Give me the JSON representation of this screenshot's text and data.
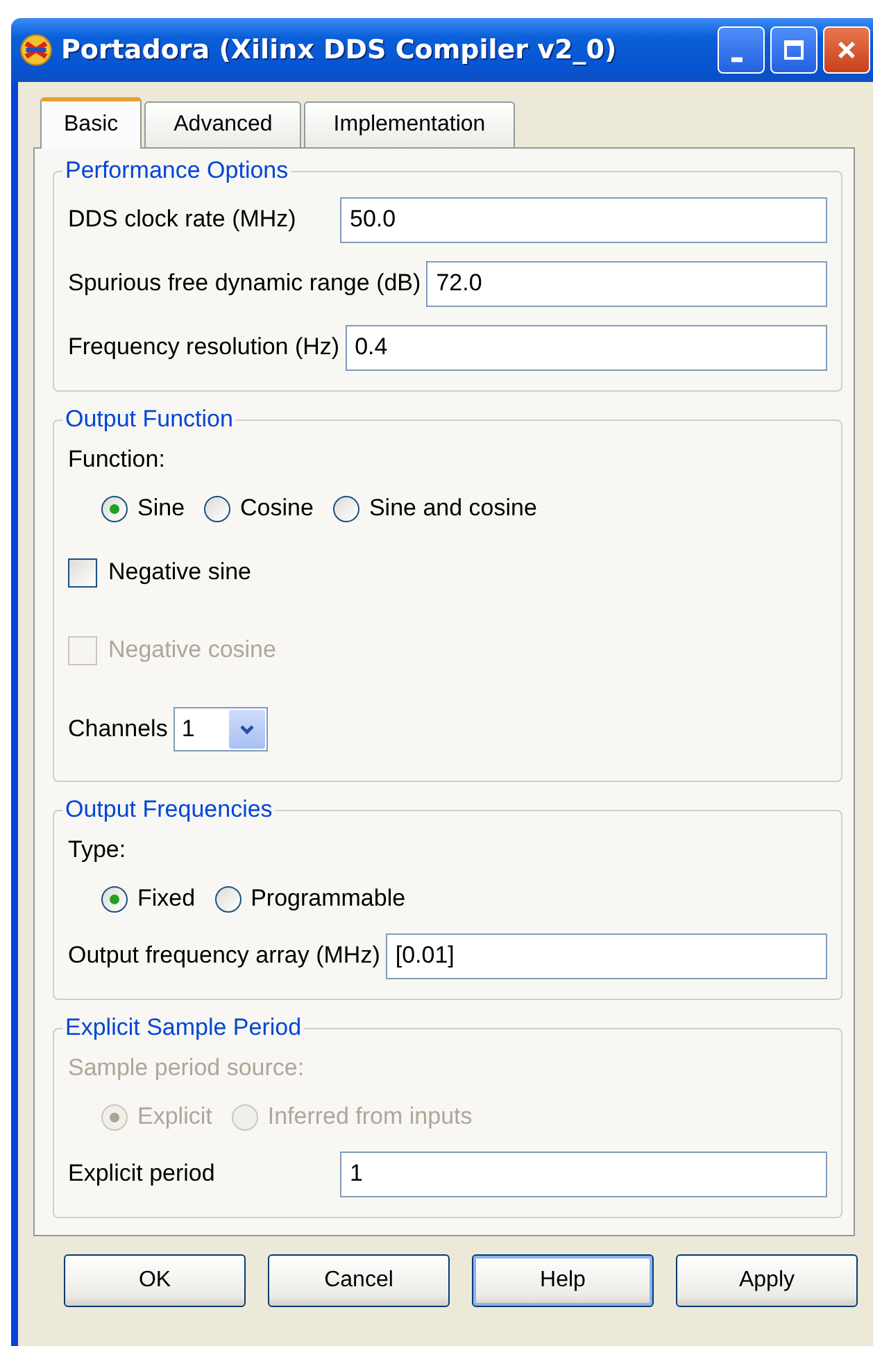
{
  "window": {
    "title": "Portadora (Xilinx DDS Compiler v2_0)"
  },
  "tabs": [
    {
      "label": "Basic",
      "selected": true
    },
    {
      "label": "Advanced",
      "selected": false
    },
    {
      "label": "Implementation",
      "selected": false
    }
  ],
  "sections": [
    {
      "title": "Performance Options",
      "rows": [
        {
          "kind": "field",
          "label": "DDS clock rate (MHz)",
          "value": "50.0",
          "disabled": false
        },
        {
          "kind": "field",
          "label": "Spurious free dynamic range (dB)",
          "value": "72.0",
          "disabled": false
        },
        {
          "kind": "field",
          "label": "Frequency resolution (Hz)",
          "value": "0.4",
          "disabled": false
        }
      ]
    },
    {
      "title": "Output Function",
      "rows": [
        {
          "kind": "label",
          "text": "Function:",
          "disabled": false
        },
        {
          "kind": "radios",
          "disabled": false,
          "options": [
            {
              "label": "Sine",
              "selected": true
            },
            {
              "label": "Cosine",
              "selected": false
            },
            {
              "label": "Sine and cosine",
              "selected": false
            }
          ]
        },
        {
          "kind": "checkbox",
          "label": "Negative sine",
          "checked": false,
          "disabled": false
        },
        {
          "kind": "checkbox",
          "label": "Negative cosine",
          "checked": false,
          "disabled": true
        },
        {
          "kind": "select",
          "label": "Channels",
          "value": "1",
          "disabled": false
        }
      ]
    },
    {
      "title": "Output Frequencies",
      "rows": [
        {
          "kind": "label",
          "text": "Type:",
          "disabled": false
        },
        {
          "kind": "radios",
          "disabled": false,
          "options": [
            {
              "label": "Fixed",
              "selected": true
            },
            {
              "label": "Programmable",
              "selected": false
            }
          ]
        },
        {
          "kind": "field",
          "label": "Output frequency array (MHz)",
          "value": "[0.01]",
          "disabled": false
        }
      ]
    },
    {
      "title": "Explicit Sample Period",
      "rows": [
        {
          "kind": "label",
          "text": "Sample period source:",
          "disabled": true
        },
        {
          "kind": "radios",
          "disabled": true,
          "options": [
            {
              "label": "Explicit",
              "selected": true
            },
            {
              "label": "Inferred from inputs",
              "selected": false
            }
          ]
        },
        {
          "kind": "field",
          "label": "Explicit period",
          "value": "1",
          "disabled": false
        }
      ]
    }
  ],
  "buttons": [
    {
      "label": "OK",
      "focused": false
    },
    {
      "label": "Cancel",
      "focused": false
    },
    {
      "label": "Help",
      "focused": true
    },
    {
      "label": "Apply",
      "focused": false
    }
  ]
}
